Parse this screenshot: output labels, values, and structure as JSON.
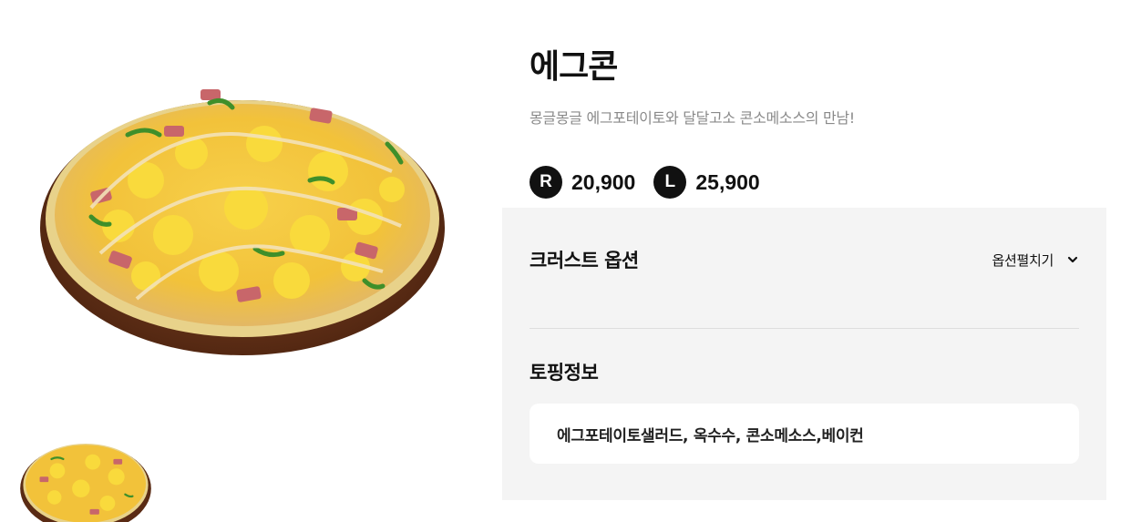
{
  "product": {
    "name": "에그콘",
    "description": "몽글몽글 에그포테이토와 달달고소 콘소메소스의 만남!"
  },
  "prices": [
    {
      "size": "R",
      "price": "20,900"
    },
    {
      "size": "L",
      "price": "25,900"
    }
  ],
  "crust_option": {
    "title": "크러스트 옵션",
    "expand_label": "옵션펼치기"
  },
  "topping": {
    "title": "토핑정보",
    "ingredients": "에그포테이토샐러드, 옥수수, 콘소메소스,베이컨"
  },
  "colors": {
    "panel_bg": "#f4f4f4",
    "badge_bg": "#111111",
    "subtitle": "#8a8a8a"
  },
  "icons": {
    "expand": "chevron-down-icon"
  }
}
